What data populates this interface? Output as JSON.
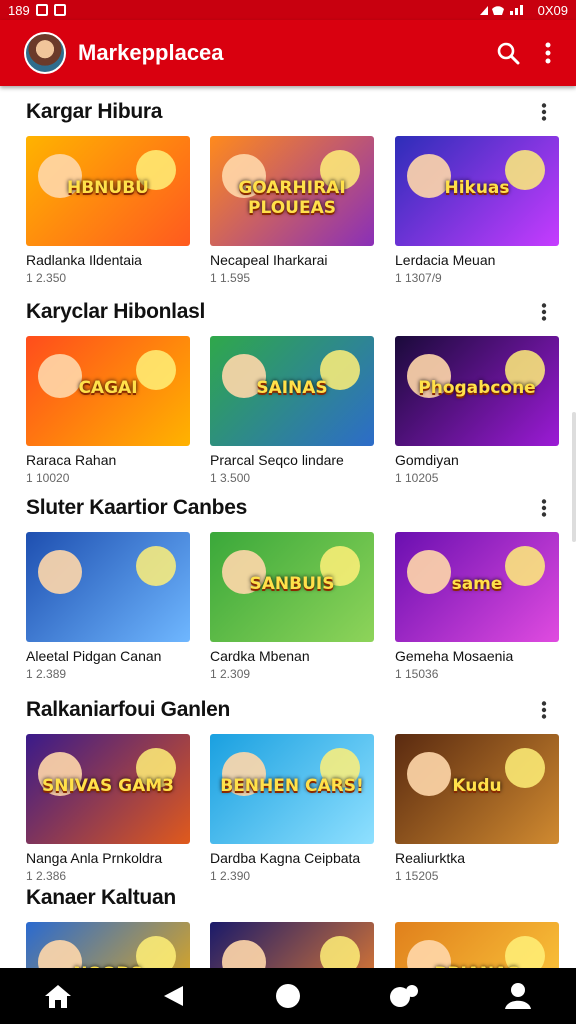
{
  "status": {
    "time_left": "189",
    "time_right": "0X09"
  },
  "app": {
    "title": "Markepplacea",
    "accent": "#d9000f"
  },
  "icons": {
    "search": "search-icon",
    "more": "kebab-menu-icon"
  },
  "sections": [
    {
      "title": "Kargar Hibura",
      "cards": [
        {
          "thumb_text": "HBNUBU",
          "title": "Radlanka Ildentaia",
          "sub": "1 2.350",
          "c1": "#ffb300",
          "c2": "#ff5a1f"
        },
        {
          "thumb_text": "GOARHIRAI PLOUEAS",
          "title": "Necapeal Iharkarai",
          "sub": "1 1.595",
          "c1": "#ff8a1c",
          "c2": "#8a2fb8"
        },
        {
          "thumb_text": "Hikuas",
          "title": "Lerdacia Meuan",
          "sub": "1 1307/9",
          "c1": "#2d2db8",
          "c2": "#c63cff"
        }
      ]
    },
    {
      "title": "Karyclar Hibonlasl",
      "cards": [
        {
          "thumb_text": "CAGAI",
          "title": "Raraca Rahan",
          "sub": "1 10020",
          "c1": "#ff4d1c",
          "c2": "#ffb300"
        },
        {
          "thumb_text": "SAINAS",
          "title": "Prarcal Seqco lindare",
          "sub": "1 3.500",
          "c1": "#2fa84a",
          "c2": "#2d6cc9"
        },
        {
          "thumb_text": "Phogabcone",
          "title": "Gomdiyan",
          "sub": "1 10205",
          "c1": "#1a0a3a",
          "c2": "#9c1bd6"
        }
      ]
    },
    {
      "title": "Sluter Kaartior Canbes",
      "cards": [
        {
          "thumb_text": "",
          "title": "Aleetal Pidgan Canan",
          "sub": "1 2.389",
          "c1": "#1e4fb0",
          "c2": "#6fb7ff"
        },
        {
          "thumb_text": "SANBUIS",
          "title": "Cardka Mbenan",
          "sub": "1 2.309",
          "c1": "#3aa83a",
          "c2": "#8ed45a"
        },
        {
          "thumb_text": "same",
          "title": "Gemeha Mosaenia",
          "sub": "1 15036",
          "c1": "#6a0fb0",
          "c2": "#e04be0"
        }
      ]
    },
    {
      "title": "Ralkaniarfoui Ganlen",
      "cards": [
        {
          "thumb_text": "SNIVAS GAM3",
          "title": "Nanga Anla Prnkoldra",
          "sub": "1 2.386",
          "c1": "#3a1a8a",
          "c2": "#e05a1c"
        },
        {
          "thumb_text": "BENHEN CARS!",
          "title": "Dardba Kagna Ceipbata",
          "sub": "1 2.390",
          "c1": "#1aa0e0",
          "c2": "#8fe0ff"
        },
        {
          "thumb_text": "Kudu",
          "title": "Realiurktka",
          "sub": "1 15205",
          "c1": "#5a2a10",
          "c2": "#d08a30"
        }
      ]
    },
    {
      "title": "Kanaer Kaltuan",
      "cards": [
        {
          "thumb_text": "NOODS",
          "title": "",
          "sub": "",
          "c1": "#2a6ad0",
          "c2": "#ffb300"
        },
        {
          "thumb_text": "",
          "title": "",
          "sub": "",
          "c1": "#1a1a6a",
          "c2": "#ff8a2a"
        },
        {
          "thumb_text": "BRIANAS",
          "title": "",
          "sub": "",
          "c1": "#e0801c",
          "c2": "#ffd040"
        }
      ]
    }
  ],
  "nav": [
    "home-icon",
    "back-icon",
    "home-circle-icon",
    "recents-icon",
    "profile-icon"
  ]
}
